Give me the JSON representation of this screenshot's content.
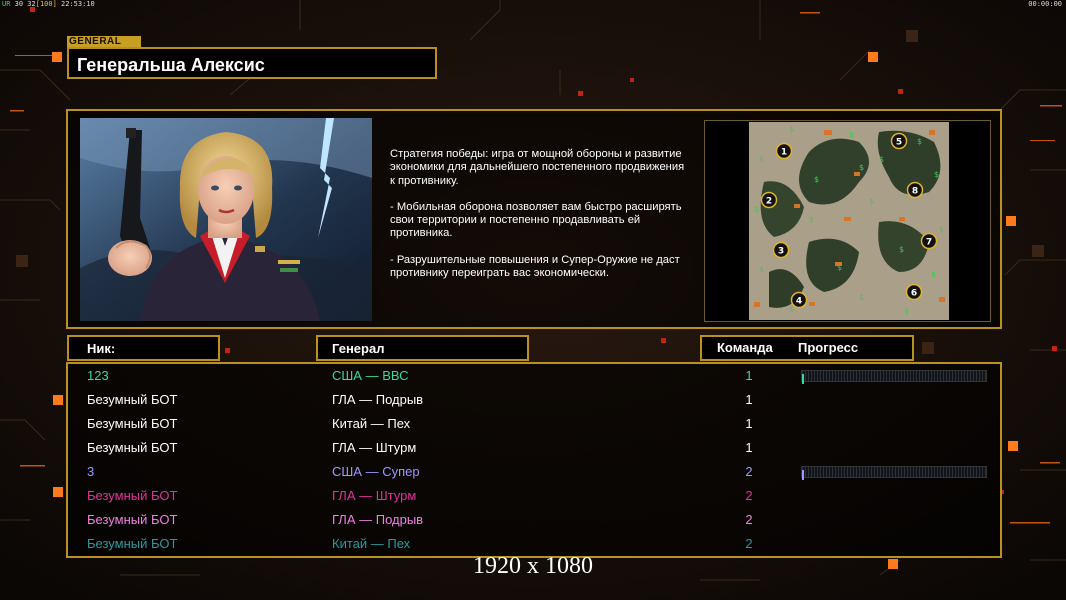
{
  "hud": {
    "left_prefix": "UR",
    "left_vals": "30 32",
    "left_bracket": "[100]",
    "left_time": "22:53:10",
    "right_time": "00:00:00"
  },
  "header": {
    "tag": "GENERAL",
    "title": "Генеральша Алексис"
  },
  "description": [
    "Стратегия победы: игра от мощной обороны и развитие экономики для дальнейшего постепенного продвижения к противнику.",
    "- Мобильная оборона позволяет вам быстро расширять свои территории и постепенно продавливать ей противника.",
    "- Разрушительные повышения и Супер-Оружие не даст противнику переиграть вас экономически."
  ],
  "map": {
    "start_positions": [
      "1",
      "2",
      "3",
      "4",
      "5",
      "6",
      "7",
      "8"
    ]
  },
  "columns": {
    "nick": "Ник:",
    "general": "Генерал",
    "team": "Команда",
    "progress": "Прогресс"
  },
  "players": [
    {
      "nick": "123",
      "general": "США — ВВС",
      "team": "1",
      "color": "#35d9a1",
      "progress": 0.01,
      "show_bar": true
    },
    {
      "nick": "Безумный БОТ",
      "general": "ГЛА — Подрыв",
      "team": "1",
      "color": "#ffffff",
      "progress": 0,
      "show_bar": false
    },
    {
      "nick": "Безумный БОТ",
      "general": "Китай — Пех",
      "team": "1",
      "color": "#ffffff",
      "progress": 0,
      "show_bar": false
    },
    {
      "nick": "Безумный БОТ",
      "general": "ГЛА — Штурм",
      "team": "1",
      "color": "#ffffff",
      "progress": 0,
      "show_bar": false
    },
    {
      "nick": "3",
      "general": "США — Супер",
      "team": "2",
      "color": "#9a9aff",
      "progress": 0.01,
      "show_bar": true
    },
    {
      "nick": "Безумный БОТ",
      "general": "ГЛА — Штурм",
      "team": "2",
      "color": "#e0339a",
      "progress": 0,
      "show_bar": false
    },
    {
      "nick": "Безумный БОТ",
      "general": "ГЛА — Подрыв",
      "team": "2",
      "color": "#f07fe3",
      "progress": 0,
      "show_bar": false
    },
    {
      "nick": "Безумный БОТ",
      "general": "Китай — Пех",
      "team": "2",
      "color": "#2a9aa0",
      "progress": 0,
      "show_bar": false
    }
  ],
  "resolution_label": "1920 x 1080",
  "colors": {
    "frame_gold": "#b8911e",
    "tag_gold": "#c79f25",
    "background": "#120c08"
  }
}
